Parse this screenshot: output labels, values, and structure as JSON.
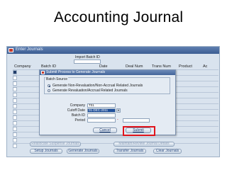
{
  "slide": {
    "title": "Accounting Journal"
  },
  "window": {
    "title": "Enter Journals"
  },
  "header": {
    "import_batch_id_label": "Import Batch ID"
  },
  "columns": [
    "Company",
    "Batch ID",
    "Date",
    "Deal Num",
    "Trans Num",
    "Product",
    "Ac"
  ],
  "bottom_buttons": {
    "reallocate": "Reallocate Suspense Journals",
    "maintain": "Maintain/Review Journal Details",
    "setup": "Setup Journals",
    "generate": "Generate Journals",
    "transfer": "Transfer Journals",
    "clear": "Clear Journals"
  },
  "dialog": {
    "title": "Submit Process to Generate Journals",
    "batch_source_label": "Batch Source",
    "options": [
      "Generate Non-Revaluation/Non-Accrual Related Journals",
      "Generate Revaluation/Accrual Related Journals"
    ],
    "selected_option": 0,
    "fields": {
      "company": {
        "label": "Company",
        "value": "T01"
      },
      "cutoff_date": {
        "label": "Cutoff Date",
        "value": "01-DEC-2011"
      },
      "batch_id": {
        "label": "Batch ID",
        "value": ""
      },
      "period": {
        "label": "Period",
        "value": ""
      }
    },
    "cancel_label": "Cancel",
    "submit_label": "Submit"
  },
  "colors": {
    "highlight": "#e0141c",
    "accent": "#3b5d92"
  }
}
